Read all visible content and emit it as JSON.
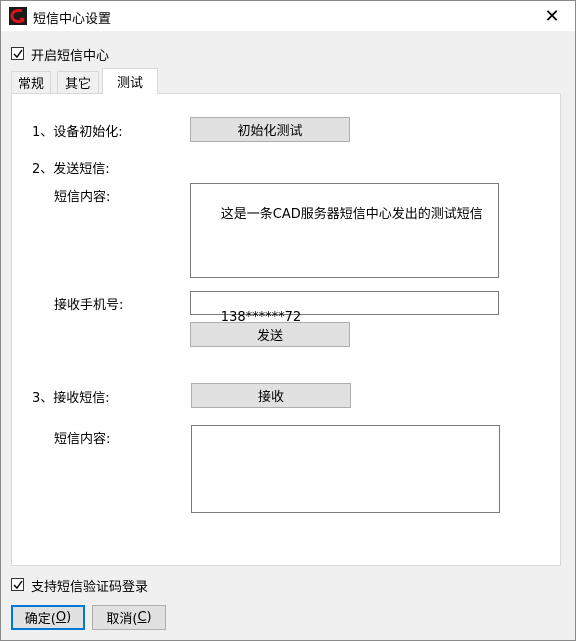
{
  "window": {
    "title": "短信中心设置",
    "close_glyph": "✕"
  },
  "enable_sms_center": {
    "label": "开启短信中心",
    "checked": true
  },
  "tabs": [
    {
      "label": "常规",
      "active": false
    },
    {
      "label": "其它",
      "active": false
    },
    {
      "label": "测试",
      "active": true
    }
  ],
  "test_panel": {
    "step1_label": "1、设备初始化:",
    "init_test_button": "初始化测试",
    "step2_label": "2、发送短信:",
    "send_content_label": "短信内容:",
    "send_content_value": "这是一条CAD服务器短信中心发出的测试短信",
    "phone_label": "接收手机号:",
    "phone_value": "138******72",
    "send_button": "发送",
    "step3_label": "3、接收短信:",
    "receive_button": "接收",
    "receive_content_label": "短信内容:",
    "receive_content_value": ""
  },
  "sms_login": {
    "label": "支持短信验证码登录",
    "checked": true
  },
  "footer": {
    "ok_label": "确定(",
    "ok_key": "O",
    "ok_suffix": ")",
    "cancel_label": "取消(",
    "cancel_key": "C",
    "cancel_suffix": ")"
  },
  "colors": {
    "app_icon_red": "#d7141a",
    "app_icon_dark": "#1a1a1a",
    "default_button_border": "#0078d7"
  }
}
